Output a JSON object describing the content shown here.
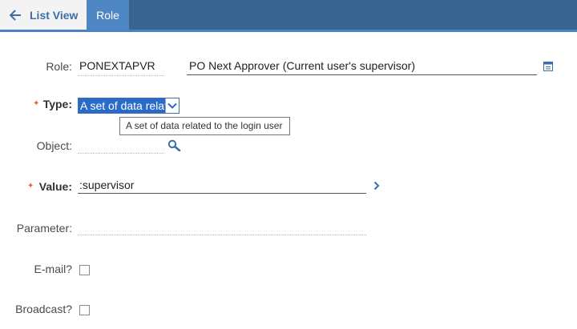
{
  "tabs": {
    "list_view": "List View",
    "role": "Role"
  },
  "form": {
    "role": {
      "label": "Role:",
      "code": "PONEXTAPVR",
      "description": "PO Next Approver (Current user's supervisor)"
    },
    "type": {
      "label": "Type:",
      "selected": "A set of data related to the login user",
      "tooltip": "A set of data related to the login user"
    },
    "object": {
      "label": "Object:",
      "value": ""
    },
    "value": {
      "label": "Value:",
      "value": ":supervisor"
    },
    "parameter": {
      "label": "Parameter:",
      "value": ""
    },
    "email": {
      "label": "E-mail?",
      "checked": false
    },
    "broadcast": {
      "label": "Broadcast?",
      "checked": false
    }
  },
  "icons": {
    "back": "arrow-left-icon",
    "details": "long-description-icon",
    "select": "chevron-down-icon",
    "lookup": "magnifier-icon",
    "goto": "chevron-right-icon"
  },
  "colors": {
    "header": "#3a6590",
    "active_tab": "#4f86c4",
    "required_star": "#e2662d",
    "link": "#3b6fa5"
  }
}
